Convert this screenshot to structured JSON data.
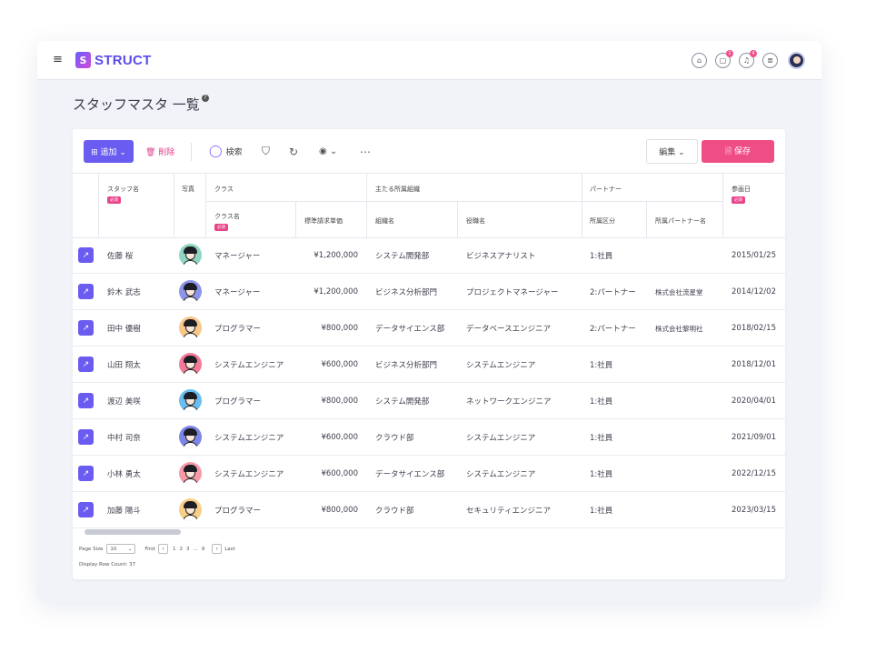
{
  "app": {
    "logo_letter": "S",
    "logo_text": "STRUCT",
    "menu_icon": "≡"
  },
  "header": {
    "icons": [
      {
        "name": "home-icon",
        "glyph": "⌂",
        "badge": ""
      },
      {
        "name": "chat-icon",
        "glyph": "▢",
        "badge": "1"
      },
      {
        "name": "bell-icon",
        "glyph": "♫",
        "badge": "4"
      },
      {
        "name": "note-icon",
        "glyph": "≣",
        "badge": ""
      }
    ]
  },
  "page": {
    "title": "スタッフマスタ 一覧",
    "help": "?"
  },
  "toolbar": {
    "add_label": "⊞ 追加 ⌄",
    "delete_label": "🗑 削除",
    "search_icon": "◯",
    "search_label": "検索",
    "filter_icon": "⛉",
    "refresh_icon": "↻",
    "view_icon": "◉ ⌄",
    "more_icon": "⋯",
    "edit_label": "編集 ⌄",
    "save_label": "🗎 保存"
  },
  "columns": {
    "staff_name": "スタッフ名",
    "photo": "写真",
    "class_group": "クラス",
    "class_name": "クラス名",
    "rate": "標準請求単価",
    "org_group": "主たる所属組織",
    "org_name": "組織名",
    "role": "役職名",
    "partner_group": "パートナー",
    "partner_type": "所属区分",
    "partner_company": "所属パートナー名",
    "join_date": "参画日",
    "required": "必須"
  },
  "rows": [
    {
      "name": "佐藤 桜",
      "class": "マネージャー",
      "rate": "¥1,200,000",
      "org": "システム開発部",
      "role": "ビジネスアナリスト",
      "type": "1:社員",
      "partner": "",
      "date": "2015/01/25",
      "color": "#8fd6c2"
    },
    {
      "name": "鈴木 武志",
      "class": "マネージャー",
      "rate": "¥1,200,000",
      "org": "ビジネス分析部門",
      "role": "プロジェクトマネージャー",
      "type": "2:パートナー",
      "partner": "株式会社流星堂",
      "date": "2014/12/02",
      "color": "#8d95e8"
    },
    {
      "name": "田中 優樹",
      "class": "プログラマー",
      "rate": "¥800,000",
      "org": "データサイエンス部",
      "role": "データベースエンジニア",
      "type": "2:パートナー",
      "partner": "株式会社黎明社",
      "date": "2018/02/15",
      "color": "#f7c78a"
    },
    {
      "name": "山田 翔太",
      "class": "システムエンジニア",
      "rate": "¥600,000",
      "org": "ビジネス分析部門",
      "role": "システムエンジニア",
      "type": "1:社員",
      "partner": "",
      "date": "2018/12/01",
      "color": "#f27a98"
    },
    {
      "name": "渡辺 美咲",
      "class": "プログラマー",
      "rate": "¥800,000",
      "org": "システム開発部",
      "role": "ネットワークエンジニア",
      "type": "1:社員",
      "partner": "",
      "date": "2020/04/01",
      "color": "#6bbcf0"
    },
    {
      "name": "中村 司奈",
      "class": "システムエンジニア",
      "rate": "¥600,000",
      "org": "クラウド部",
      "role": "システムエンジニア",
      "type": "1:社員",
      "partner": "",
      "date": "2021/09/01",
      "color": "#7d85e6"
    },
    {
      "name": "小林 勇太",
      "class": "システムエンジニア",
      "rate": "¥600,000",
      "org": "データサイエンス部",
      "role": "システムエンジニア",
      "type": "1:社員",
      "partner": "",
      "date": "2022/12/15",
      "color": "#f79aa6"
    },
    {
      "name": "加藤 陽斗",
      "class": "プログラマー",
      "rate": "¥800,000",
      "org": "クラウド部",
      "role": "セキュリティエンジニア",
      "type": "1:社員",
      "partner": "",
      "date": "2023/03/15",
      "color": "#f7cf86"
    }
  ],
  "pager": {
    "page_size_label": "Page Size",
    "page_size_value": "10",
    "first_label": "First",
    "prev": "‹",
    "pages": [
      "1",
      "2",
      "3",
      "...",
      "9"
    ],
    "next": "›",
    "last_label": "Last",
    "row_count": "Display Row Count: 37"
  }
}
